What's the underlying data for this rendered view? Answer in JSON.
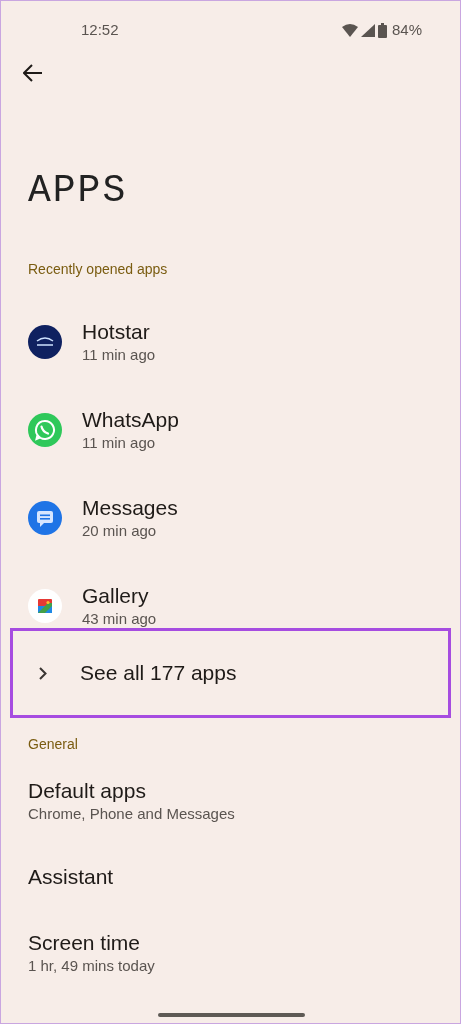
{
  "status_bar": {
    "time": "12:52",
    "battery": "84%"
  },
  "title": "APPS",
  "recent": {
    "header": "Recently opened apps",
    "apps": [
      {
        "name": "Hotstar",
        "time": "11 min ago",
        "kind": "hotstar"
      },
      {
        "name": "WhatsApp",
        "time": "11 min ago",
        "kind": "whatsapp"
      },
      {
        "name": "Messages",
        "time": "20 min ago",
        "kind": "messages"
      },
      {
        "name": "Gallery",
        "time": "43 min ago",
        "kind": "gallery"
      }
    ],
    "see_all": {
      "label": "See all 177 apps",
      "highlighted": true
    }
  },
  "general": {
    "header": "General",
    "items": [
      {
        "title": "Default apps",
        "subtitle": "Chrome, Phone and Messages"
      },
      {
        "title": "Assistant"
      },
      {
        "title": "Screen time",
        "subtitle": "1 hr, 49 mins today"
      }
    ]
  }
}
